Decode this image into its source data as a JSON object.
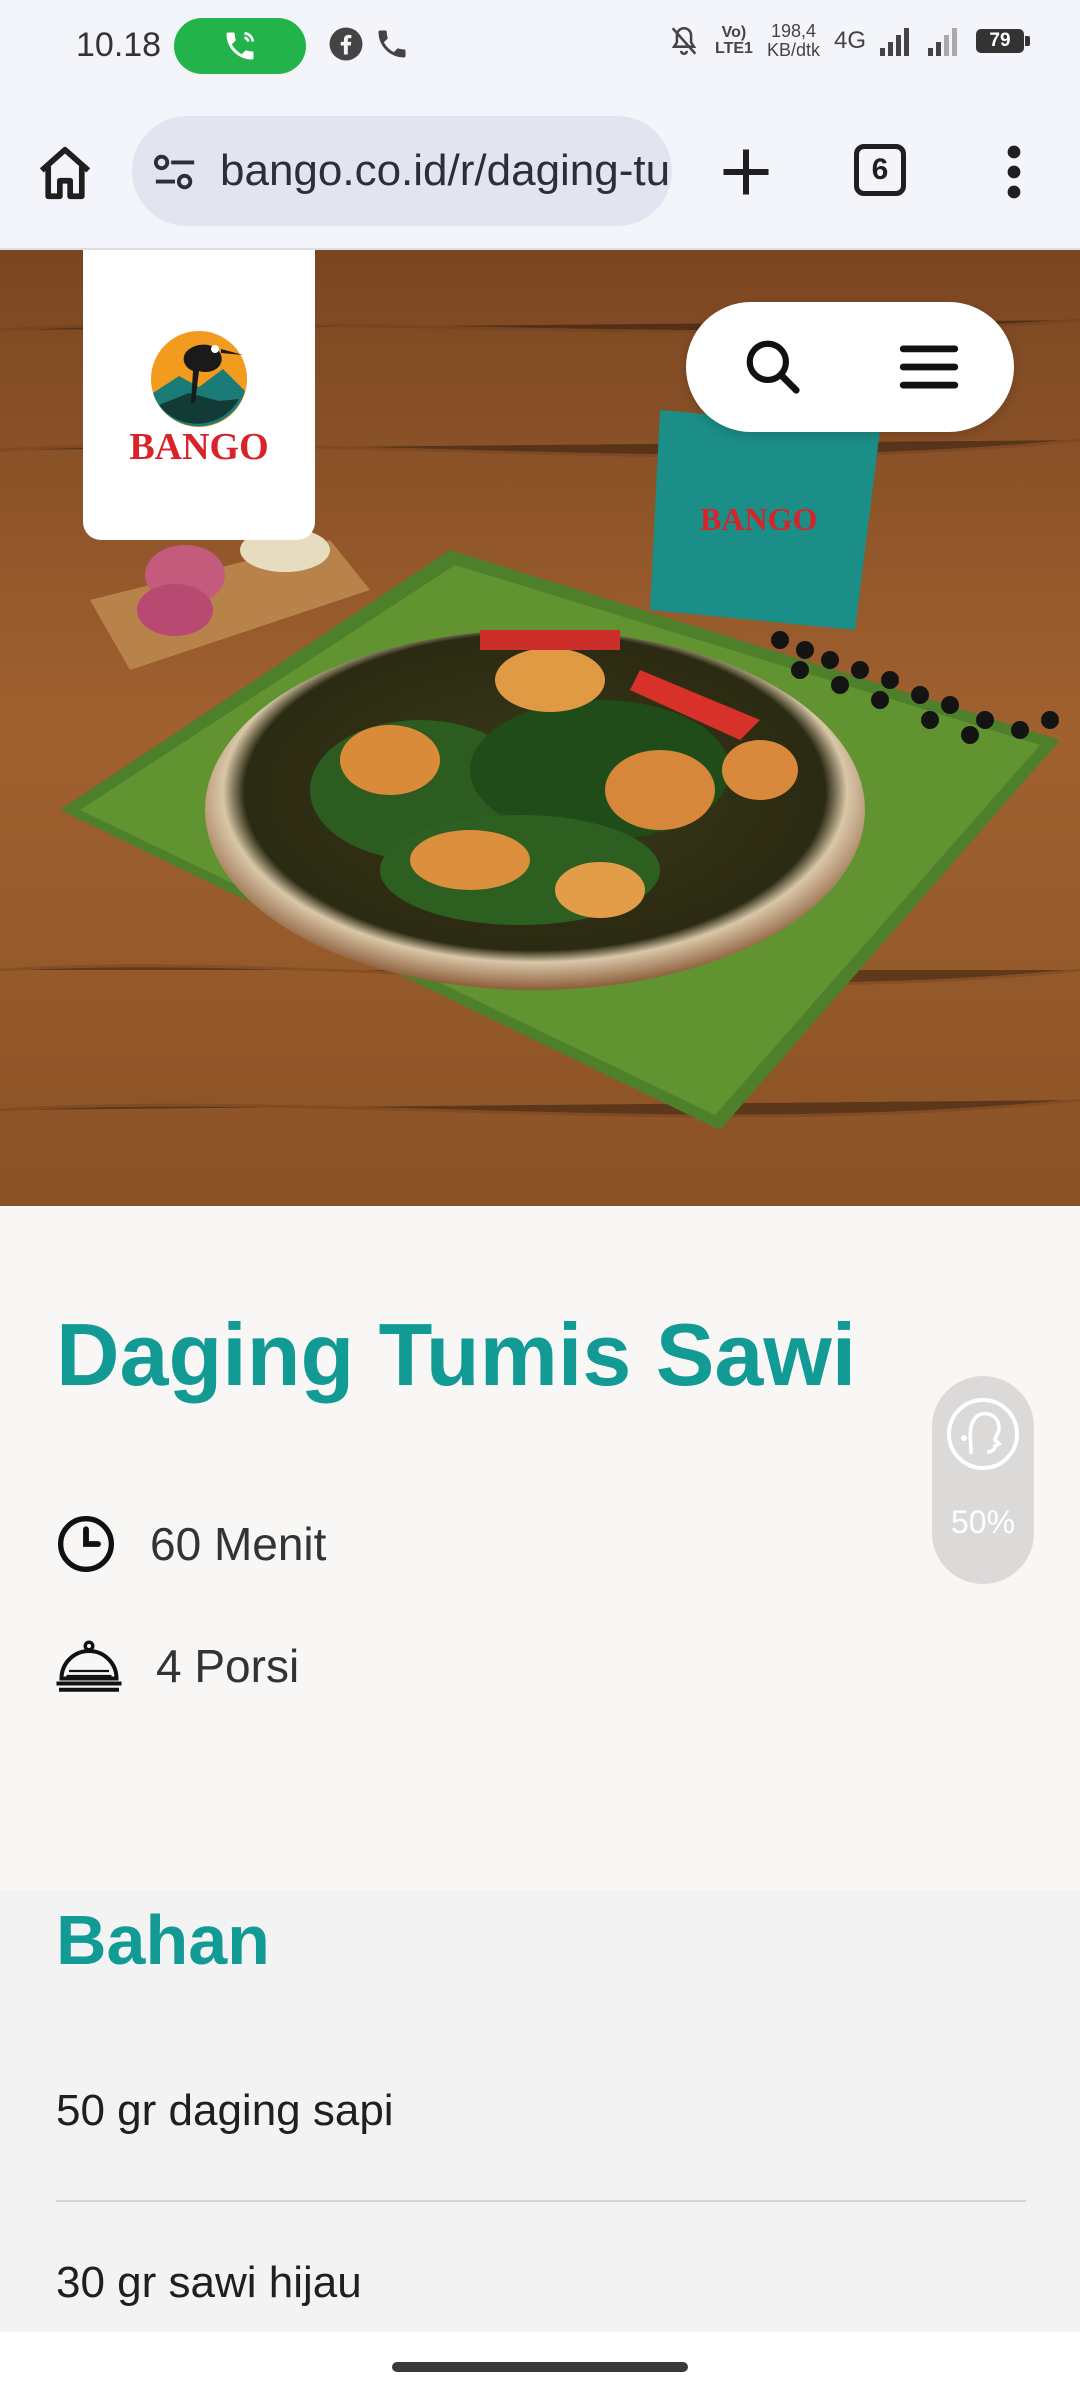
{
  "status_bar": {
    "time": "10.18",
    "network_label": "Vo) LTE1",
    "speed_value": "198,4",
    "speed_unit": "KB/dtk",
    "network_type": "4G",
    "battery": "79"
  },
  "browser": {
    "url": "bango.co.id/r/daging-tumis-sawi",
    "tab_count": "6"
  },
  "brand": {
    "name": "BANGO"
  },
  "recipe": {
    "title": "Daging Tumis Sawi",
    "duration": "60 Menit",
    "portions": "4 Porsi",
    "accessibility_level": "50%"
  },
  "ingredients": {
    "heading": "Bahan",
    "items": [
      "50 gr daging sapi",
      "30 gr sawi hijau"
    ]
  },
  "colors": {
    "accent": "#129a94",
    "brand_red": "#d8232a",
    "call_green": "#22b44b"
  }
}
